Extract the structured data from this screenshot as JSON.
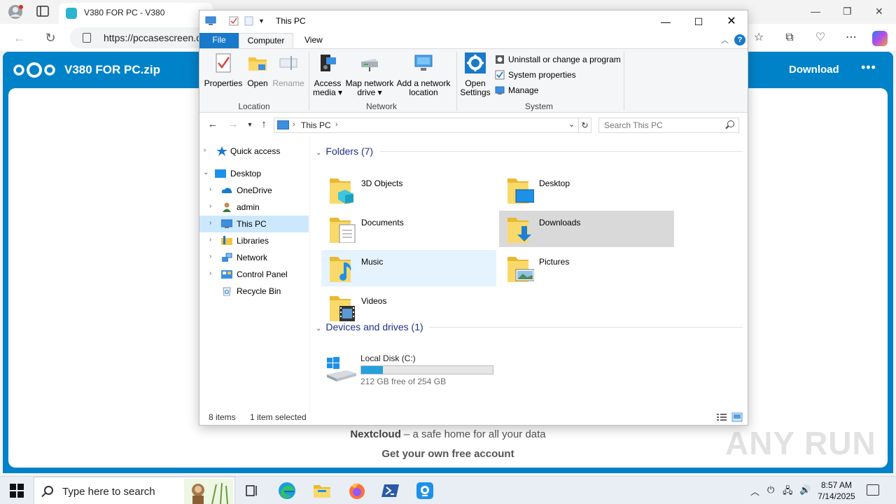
{
  "browser": {
    "tab_title": "V380 FOR PC - V380",
    "url": "https://pccasescreen.c",
    "colors": {
      "accent": "#0082c9"
    }
  },
  "nextcloud": {
    "filename": "V380 FOR PC.zip",
    "download_label": "Download",
    "more_label": "•••",
    "footer_brand": "Nextcloud",
    "footer_tagline": " – a safe home for all your data",
    "footer_cta": "Get your own free account",
    "watermark": "ANY RUN"
  },
  "explorer": {
    "title": "This PC",
    "ribbon_tabs": [
      "File",
      "Computer",
      "View"
    ],
    "ribbon": {
      "location": {
        "label": "Location",
        "properties": "Properties",
        "open": "Open",
        "rename": "Rename"
      },
      "network": {
        "label": "Network",
        "access_media_1": "Access",
        "access_media_2": "media ▾",
        "map_drive_1": "Map network",
        "map_drive_2": "drive ▾",
        "add_location_1": "Add a network",
        "add_location_2": "location"
      },
      "system": {
        "label": "System",
        "open_settings_1": "Open",
        "open_settings_2": "Settings",
        "uninstall": "Uninstall or change a program",
        "sys_props": "System properties",
        "manage": "Manage"
      }
    },
    "address": {
      "crumb": "This PC"
    },
    "search": {
      "placeholder": "Search This PC"
    },
    "tree": [
      {
        "label": "Quick access"
      },
      {
        "label": "Desktop"
      },
      {
        "label": "OneDrive"
      },
      {
        "label": "admin"
      },
      {
        "label": "This PC"
      },
      {
        "label": "Libraries"
      },
      {
        "label": "Network"
      },
      {
        "label": "Control Panel"
      },
      {
        "label": "Recycle Bin"
      }
    ],
    "folders_header": "Folders (7)",
    "folders": [
      {
        "name": "3D Objects"
      },
      {
        "name": "Desktop"
      },
      {
        "name": "Documents"
      },
      {
        "name": "Downloads"
      },
      {
        "name": "Music"
      },
      {
        "name": "Pictures"
      },
      {
        "name": "Videos"
      }
    ],
    "drives_header": "Devices and drives (1)",
    "drive": {
      "name": "Local Disk (C:)",
      "free_text": "212 GB free of 254 GB",
      "used_fraction": 0.165
    },
    "status": {
      "items": "8 items",
      "selected": "1 item selected"
    }
  },
  "taskbar": {
    "search_placeholder": "Type here to search",
    "time": "8:57 AM",
    "date": "7/14/2025"
  }
}
